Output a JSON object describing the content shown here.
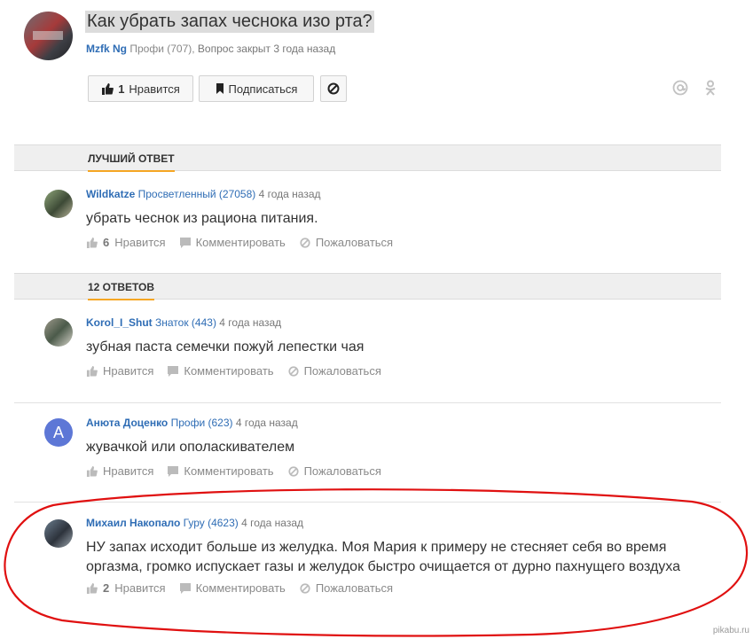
{
  "question": {
    "title": "Как убрать запах чеснока изо рта?",
    "author": "Mzfk Ng",
    "rank": "Профи (707),",
    "status": "Вопрос закрыт 3 года назад"
  },
  "toolbar": {
    "like_count": "1",
    "like_label": "Нравится",
    "subscribe_label": "Подписаться"
  },
  "sections": {
    "best_answer": "ЛУЧШИЙ ОТВЕТ",
    "answers_count": "12 ОТВЕТОВ"
  },
  "answers": [
    {
      "author": "Wildkatze",
      "rank": "Просветленный (27058)",
      "time": "4 года назад",
      "text": "убрать чеснок из рациона питания.",
      "likes": "6",
      "like_label": "Нравится",
      "comment_label": "Комментировать",
      "report_label": "Пожаловаться"
    },
    {
      "author": "Korol_I_Shut",
      "rank": "Знаток (443)",
      "time": "4 года назад",
      "text": "зубная паста семечки пожуй лепестки чая",
      "likes": "",
      "like_label": "Нравится",
      "comment_label": "Комментировать",
      "report_label": "Пожаловаться"
    },
    {
      "author": "Анюта Доценко",
      "avatar_letter": "А",
      "rank": "Профи (623)",
      "time": "4 года назад",
      "text": "жувачкой или ополаскивателем",
      "likes": "",
      "like_label": "Нравится",
      "comment_label": "Комментировать",
      "report_label": "Пожаловаться"
    },
    {
      "author": "Михаил Накопало",
      "rank": "Гуру (4623)",
      "time": "4 года назад",
      "text": "НУ запах исходит больше из желудка. Моя Мария к примеру не стесняет себя во время оргазма, громко испускает газы и желудок быстро очищается от дурно пахнущего воздуха",
      "likes": "2",
      "like_label": "Нравится",
      "comment_label": "Комментировать",
      "report_label": "Пожаловаться"
    }
  ],
  "watermark": "pikabu.ru",
  "colors": {
    "link": "#2f6db5",
    "accent": "#f5a623",
    "highlight_ring": "#e01010",
    "letter_avatar": "#5d77d6"
  },
  "icons": [
    "thumb-up-icon",
    "bookmark-icon",
    "block-icon",
    "at-icon",
    "odnoklassniki-icon",
    "comment-icon",
    "report-icon"
  ]
}
